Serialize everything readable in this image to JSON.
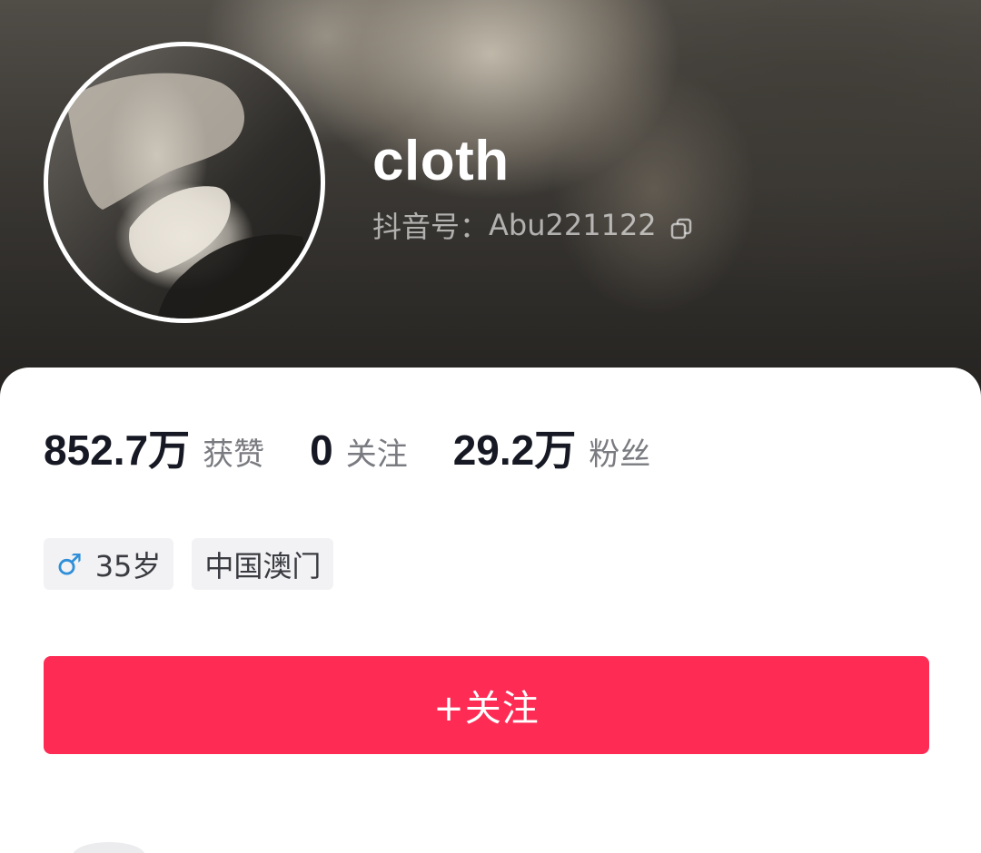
{
  "profile": {
    "nickname": "cloth",
    "account_label": "抖音号：",
    "account_id": "Abu221122"
  },
  "stats": [
    {
      "value": "852.7万",
      "label": "获赞"
    },
    {
      "value": "0",
      "label": "关注"
    },
    {
      "value": "29.2万",
      "label": "粉丝"
    }
  ],
  "tags": {
    "gender_symbol": "♂",
    "age": "35岁",
    "location": "中国澳门"
  },
  "actions": {
    "follow_label": "+关注"
  },
  "colors": {
    "accent": "#fe2c55",
    "gender_male": "#2f8fd8",
    "text_primary": "#161823",
    "text_secondary": "#7a7b80"
  },
  "icons": {
    "copy": "copy-icon",
    "gender": "male-gender-icon"
  }
}
